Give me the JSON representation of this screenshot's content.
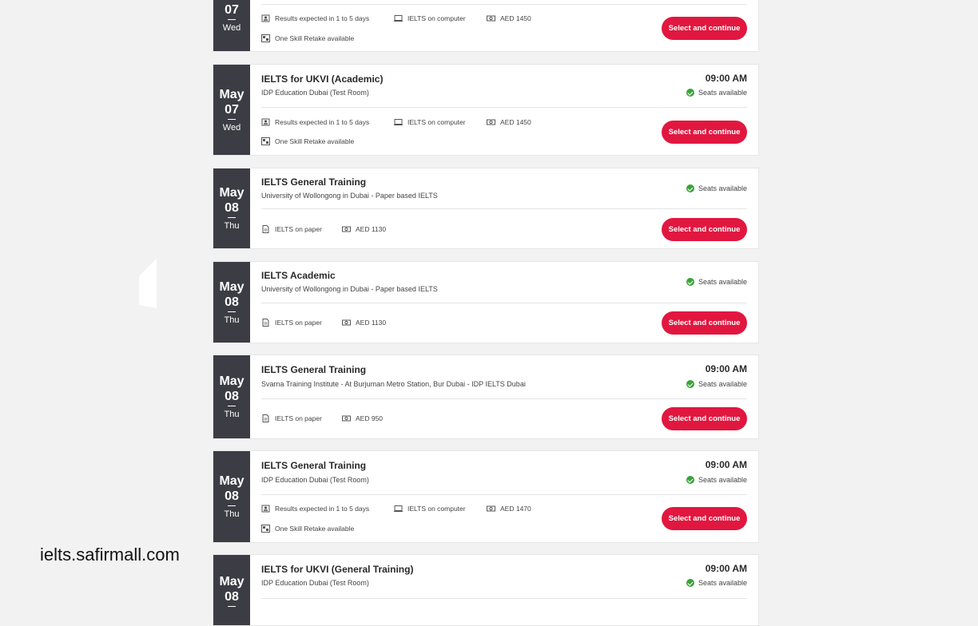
{
  "watermark": "ielts.safirmall.com",
  "cards": [
    {
      "date": {
        "month": "",
        "day": "07",
        "weekday": "Wed"
      },
      "title": "",
      "venue": "",
      "time": "",
      "seats": "",
      "features": [
        "Results expected in 1 to 5 days",
        "IELTS on computer",
        "AED 1450",
        "One Skill Retake available"
      ],
      "button": "Select and continue"
    },
    {
      "date": {
        "month": "May",
        "day": "07",
        "weekday": "Wed"
      },
      "title": "IELTS for UKVI (Academic)",
      "venue": "IDP Education Dubai (Test Room)",
      "time": "09:00 AM",
      "seats": "Seats available",
      "features": [
        "Results expected in 1 to 5 days",
        "IELTS on computer",
        "AED 1450",
        "One Skill Retake available"
      ],
      "button": "Select and continue"
    },
    {
      "date": {
        "month": "May",
        "day": "08",
        "weekday": "Thu"
      },
      "title": "IELTS General Training",
      "venue": "University of Wollongong in Dubai - Paper based IELTS",
      "time": "",
      "seats": "Seats available",
      "features": [
        "IELTS on paper",
        "AED 1130"
      ],
      "button": "Select and continue"
    },
    {
      "date": {
        "month": "May",
        "day": "08",
        "weekday": "Thu"
      },
      "title": "IELTS Academic",
      "venue": "University of Wollongong in Dubai - Paper based IELTS",
      "time": "",
      "seats": "Seats available",
      "features": [
        "IELTS on paper",
        "AED 1130"
      ],
      "button": "Select and continue"
    },
    {
      "date": {
        "month": "May",
        "day": "08",
        "weekday": "Thu"
      },
      "title": "IELTS General Training",
      "venue": "Svarna Training Institute - At Burjuman Metro Station, Bur Dubai - IDP IELTS Dubai",
      "time": "09:00 AM",
      "seats": "Seats available",
      "features": [
        "IELTS on paper",
        "AED 950"
      ],
      "button": "Select and continue"
    },
    {
      "date": {
        "month": "May",
        "day": "08",
        "weekday": "Thu"
      },
      "title": "IELTS General Training",
      "venue": "IDP Education Dubai (Test Room)",
      "time": "09:00 AM",
      "seats": "Seats available",
      "features": [
        "Results expected in 1 to 5 days",
        "IELTS on computer",
        "AED 1470",
        "One Skill Retake available"
      ],
      "button": "Select and continue"
    },
    {
      "date": {
        "month": "May",
        "day": "08",
        "weekday": ""
      },
      "title": "IELTS for UKVI (General Training)",
      "venue": "IDP Education Dubai (Test Room)",
      "time": "09:00 AM",
      "seats": "Seats available",
      "features": [],
      "button": ""
    }
  ]
}
